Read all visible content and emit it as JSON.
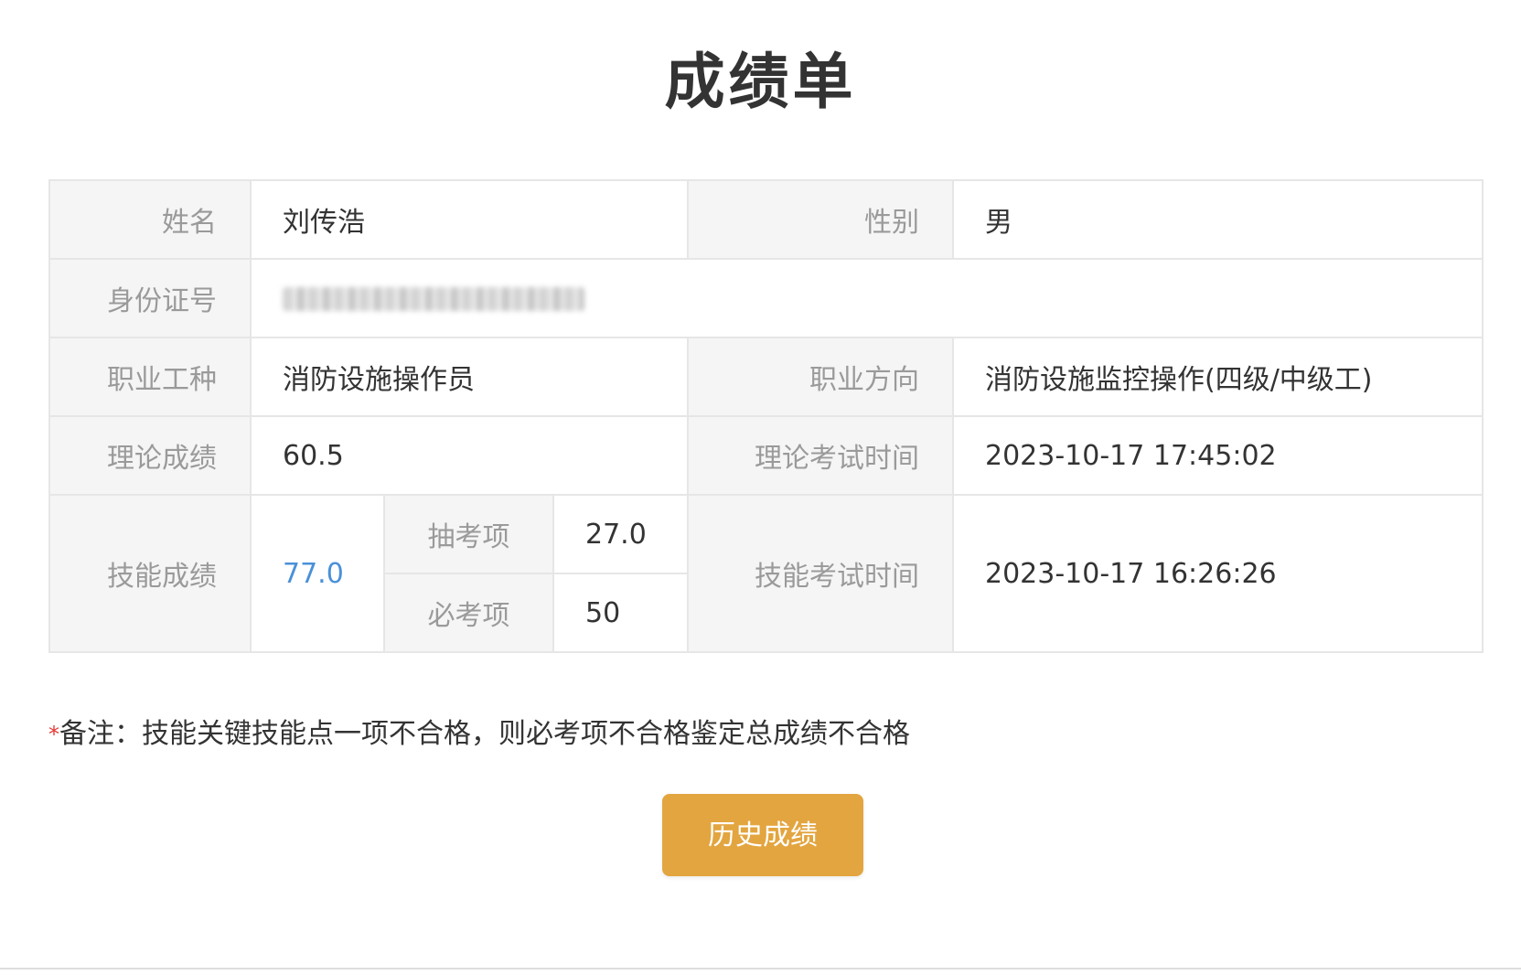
{
  "page_title": "成绩单",
  "fields": {
    "name_label": "姓名",
    "name_value": "刘传浩",
    "gender_label": "性别",
    "gender_value": "男",
    "id_label": "身份证号",
    "occupation_label": "职业工种",
    "occupation_value": "消防设施操作员",
    "direction_label": "职业方向",
    "direction_value": "消防设施监控操作(四级/中级工)",
    "theory_label": "理论成绩",
    "theory_value": "60.5",
    "theory_time_label": "理论考试时间",
    "theory_time_value": "2023-10-17 17:45:02",
    "skill_label": "技能成绩",
    "skill_value": "77.0",
    "random_item_label": "抽考项",
    "random_item_value": "27.0",
    "required_item_label": "必考项",
    "required_item_value": "50",
    "skill_time_label": "技能考试时间",
    "skill_time_value": "2023-10-17 16:26:26"
  },
  "note": {
    "star": "*",
    "text": "备注：技能关键技能点一项不合格，则必考项不合格鉴定总成绩不合格"
  },
  "buttons": {
    "history": "历史成绩"
  },
  "colors": {
    "accent_button": "#e3a53f",
    "highlight_value": "#4a90d9",
    "label_text": "#9a9a9a",
    "label_bg": "#f5f5f5",
    "note_star": "#e53935"
  }
}
